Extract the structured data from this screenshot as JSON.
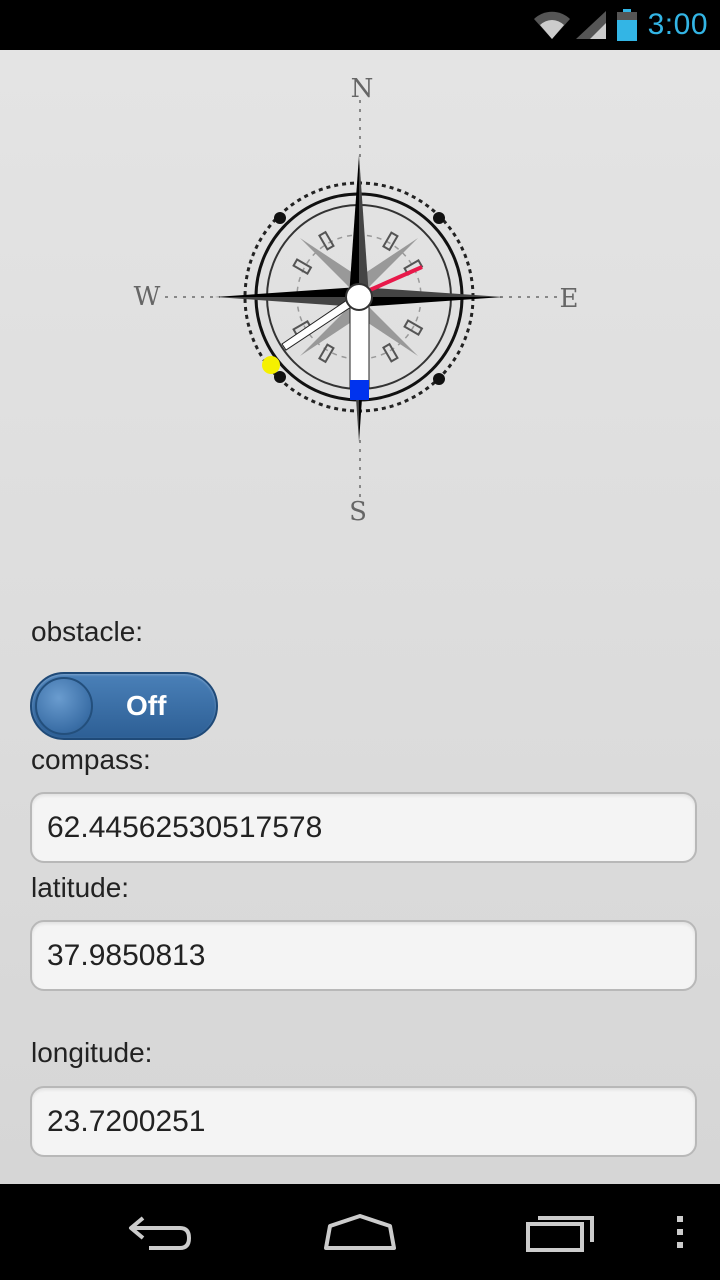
{
  "status_bar": {
    "time": "3:00",
    "icons": [
      "wifi-icon",
      "signal-icon",
      "battery-icon"
    ]
  },
  "compass": {
    "labels": {
      "north": "N",
      "south": "S",
      "east": "E",
      "west": "W"
    },
    "colors": {
      "needle_red": "#e8194a",
      "needle_blue": "#0033ee",
      "marker_yellow": "#f5f000"
    }
  },
  "fields": {
    "obstacle": {
      "label": "obstacle:",
      "toggle_value": "Off"
    },
    "compass": {
      "label": "compass:",
      "value": "62.44562530517578"
    },
    "latitude": {
      "label": "latitude:",
      "value": "37.9850813"
    },
    "longitude": {
      "label": "longitude:",
      "value": "23.7200251"
    }
  },
  "nav_bar": {
    "buttons": [
      "back-icon",
      "home-icon",
      "recents-icon",
      "menu-icon"
    ]
  },
  "colors": {
    "status_accent": "#33b5e5",
    "toggle_blue": "#3a6ea6"
  }
}
